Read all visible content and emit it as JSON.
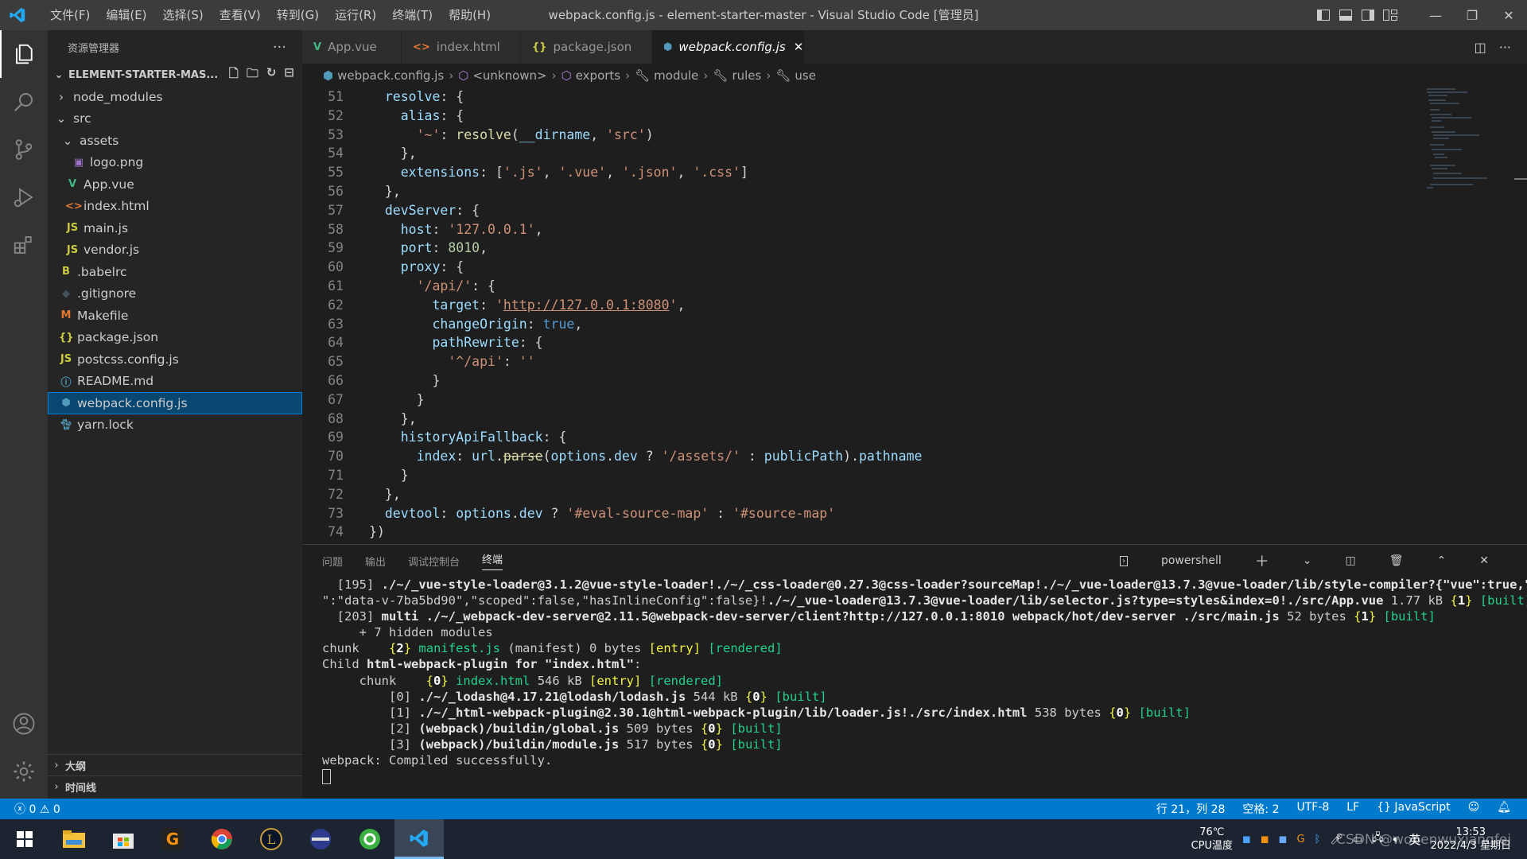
{
  "titlebar": {
    "menu": [
      "文件(F)",
      "编辑(E)",
      "选择(S)",
      "查看(V)",
      "转到(G)",
      "运行(R)",
      "终端(T)",
      "帮助(H)"
    ],
    "title": "webpack.config.js - element-starter-master - Visual Studio Code [管理员]"
  },
  "sidebar": {
    "title": "资源管理器",
    "project": "ELEMENT-STARTER-MAS...",
    "tree": [
      {
        "label": "node_modules",
        "icon": "chevron-right",
        "indent": 1
      },
      {
        "label": "src",
        "icon": "chevron-down",
        "indent": 1
      },
      {
        "label": "assets",
        "icon": "chevron-down",
        "indent": 2
      },
      {
        "label": "logo.png",
        "icon": "image-icon",
        "indent": 3
      },
      {
        "label": "App.vue",
        "icon": "vue-icon",
        "indent": 2
      },
      {
        "label": "index.html",
        "icon": "html-icon",
        "indent": 2
      },
      {
        "label": "main.js",
        "icon": "js-icon",
        "indent": 2
      },
      {
        "label": "vendor.js",
        "icon": "js-icon",
        "indent": 2
      },
      {
        "label": ".babelrc",
        "icon": "babel-icon",
        "indent": 1
      },
      {
        "label": ".gitignore",
        "icon": "git-icon",
        "indent": 1
      },
      {
        "label": "Makefile",
        "icon": "makefile-icon",
        "indent": 1
      },
      {
        "label": "package.json",
        "icon": "json-icon",
        "indent": 1
      },
      {
        "label": "postcss.config.js",
        "icon": "js-icon",
        "indent": 1
      },
      {
        "label": "README.md",
        "icon": "info-icon",
        "indent": 1
      },
      {
        "label": "webpack.config.js",
        "icon": "webpack-icon",
        "indent": 1,
        "selected": true
      },
      {
        "label": "yarn.lock",
        "icon": "yarn-icon",
        "indent": 1
      }
    ],
    "outline": "大纲",
    "timeline": "时间线"
  },
  "tabs": [
    {
      "label": "App.vue",
      "icon": "vue-icon"
    },
    {
      "label": "index.html",
      "icon": "html-icon"
    },
    {
      "label": "package.json",
      "icon": "json-icon"
    },
    {
      "label": "webpack.config.js",
      "icon": "webpack-icon",
      "active": true
    }
  ],
  "breadcrumb": [
    "webpack.config.js",
    "<unknown>",
    "exports",
    "module",
    "rules",
    "use"
  ],
  "code": {
    "line_numbers": [
      "51",
      "52",
      "53",
      "54",
      "55",
      "56",
      "57",
      "58",
      "59",
      "60",
      "61",
      "62",
      "63",
      "64",
      "65",
      "66",
      "67",
      "68",
      "69",
      "70",
      "71",
      "72",
      "73",
      "74"
    ],
    "lines": [
      "  resolve: {",
      "    alias: {",
      "      '~': resolve(__dirname, 'src')",
      "    },",
      "    extensions: ['.js', '.vue', '.json', '.css']",
      "  },",
      "  devServer: {",
      "    host: '127.0.0.1',",
      "    port: 8010,",
      "    proxy: {",
      "      '/api/': {",
      "        target: 'http://127.0.0.1:8080',",
      "        changeOrigin: true,",
      "        pathRewrite: {",
      "          '^/api': ''",
      "        }",
      "      }",
      "    },",
      "    historyApiFallback: {",
      "      index: url.parse(options.dev ? '/assets/' : publicPath).pathname",
      "    }",
      "  },",
      "  devtool: options.dev ? '#eval-source-map' : '#source-map'",
      "})"
    ]
  },
  "panel": {
    "tabs": [
      "问题",
      "输出",
      "调试控制台",
      "终端"
    ],
    "active_tab": "终端",
    "shell": "powershell",
    "terminal": [
      "  [195] ./~/_vue-style-loader@3.1.2@vue-style-loader!./~/_css-loader@0.27.3@css-loader?sourceMap!./~/_vue-loader@13.7.3@vue-loader/lib/style-compiler?{\"vue\":true,\"id",
      "\":\"data-v-7ba5bd90\",\"scoped\":false,\"hasInlineConfig\":false}!./~/_vue-loader@13.7.3@vue-loader/lib/selector.js?type=styles&index=0!./src/App.vue 1.77 kB {1} [built]",
      "  [203] multi ./~/_webpack-dev-server@2.11.5@webpack-dev-server/client?http://127.0.0.1:8010 webpack/hot/dev-server ./src/main.js 52 bytes {1} [built]",
      "     + 7 hidden modules",
      "chunk    {2} manifest.js (manifest) 0 bytes [entry] [rendered]",
      "Child html-webpack-plugin for \"index.html\":",
      "     chunk    {0} index.html 546 kB [entry] [rendered]",
      "         [0] ./~/_lodash@4.17.21@lodash/lodash.js 544 kB {0} [built]",
      "         [1] ./~/_html-webpack-plugin@2.30.1@html-webpack-plugin/lib/loader.js!./src/index.html 538 bytes {0} [built]",
      "         [2] (webpack)/buildin/global.js 509 bytes {0} [built]",
      "         [3] (webpack)/buildin/module.js 517 bytes {0} [built]",
      "webpack: Compiled successfully."
    ]
  },
  "statusbar": {
    "errors": "0",
    "warnings": "0",
    "position": "行 21，列 28",
    "spaces": "空格: 2",
    "encoding": "UTF-8",
    "eol": "LF",
    "language": "JavaScript"
  },
  "taskbar": {
    "temp": "76℃",
    "temp_label": "CPU温度",
    "time": "13:53",
    "date": "2022/4/3 星期日",
    "ime": "英",
    "watermark": "CSDN @wobenwuxiangfei"
  },
  "colors": {
    "accent": "#007acc",
    "selection": "#094771",
    "editor_bg": "#1e1e1e"
  }
}
